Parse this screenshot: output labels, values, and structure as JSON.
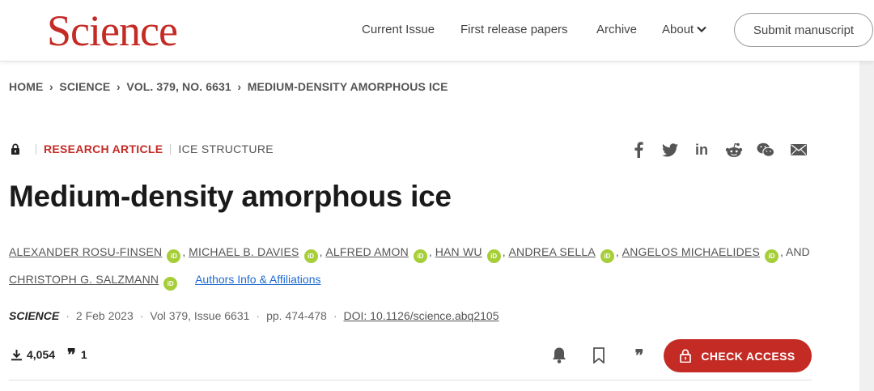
{
  "header": {
    "logo": "Science",
    "nav": [
      "Current Issue",
      "First release papers",
      "Archive",
      "About"
    ],
    "submit": "Submit manuscript"
  },
  "breadcrumb": [
    "HOME",
    "SCIENCE",
    "VOL. 379, NO. 6631",
    "MEDIUM-DENSITY AMORPHOUS ICE"
  ],
  "article": {
    "type": "RESEARCH ARTICLE",
    "topic": "ICE STRUCTURE",
    "title": "Medium-density amorphous ice",
    "authors": [
      "ALEXANDER ROSU-FINSEN",
      "MICHAEL B. DAVIES",
      "ALFRED AMON",
      "HAN WU",
      "ANDREA SELLA",
      "ANGELOS MICHAELIDES",
      "CHRISTOPH G. SALZMANN"
    ],
    "and_text": ", AND",
    "affiliations_link": "Authors Info & Affiliations",
    "journal": "SCIENCE",
    "date": "2 Feb 2023",
    "volume": "Vol 379, Issue 6631",
    "pages": "pp. 474-478",
    "doi": "DOI: 10.1126/science.abq2105",
    "downloads": "4,054",
    "citations": "1",
    "check_access": "CHECK ACCESS"
  },
  "share_icons": [
    "facebook-icon",
    "twitter-icon",
    "linkedin-icon",
    "reddit-icon",
    "wechat-icon",
    "email-icon"
  ],
  "colors": {
    "brand_red": "#c42b25",
    "orcid_green": "#a6ce39",
    "link_blue": "#1f6bd1"
  }
}
